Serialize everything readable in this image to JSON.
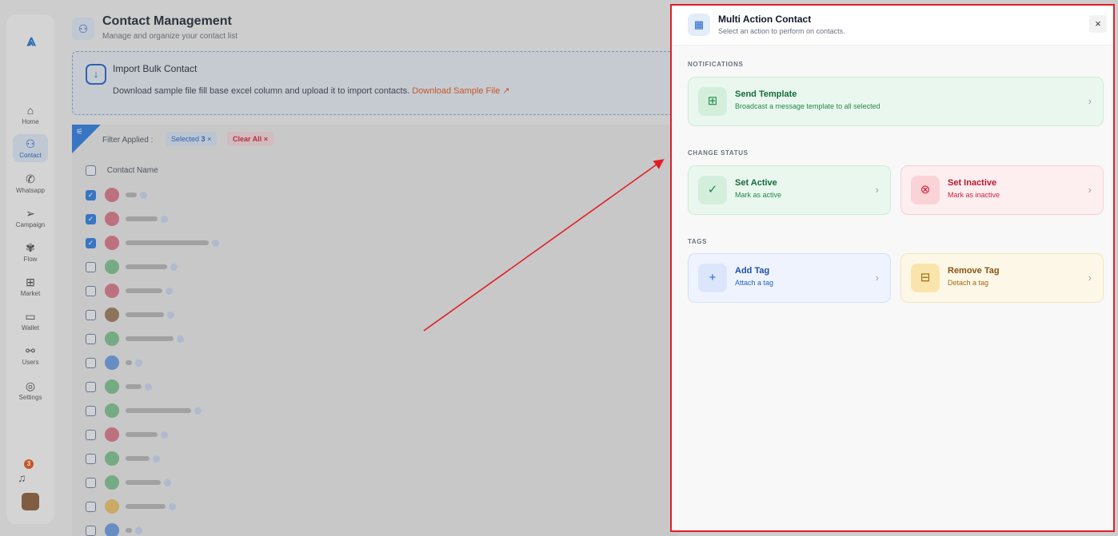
{
  "background": {
    "header": {
      "title": "Contact Management",
      "subtitle": "Manage and organize your contact list"
    },
    "sidebar": {
      "items": [
        {
          "label": "Home",
          "icon": "home-icon"
        },
        {
          "label": "Contact",
          "icon": "user-icon"
        },
        {
          "label": "Whatsapp",
          "icon": "whatsapp-icon"
        },
        {
          "label": "Campaign",
          "icon": "send-icon"
        },
        {
          "label": "Flow",
          "icon": "flow-icon"
        },
        {
          "label": "Market",
          "icon": "store-icon"
        },
        {
          "label": "Wallet",
          "icon": "wallet-icon"
        },
        {
          "label": "Users",
          "icon": "users-icon"
        },
        {
          "label": "Settings",
          "icon": "settings-icon"
        }
      ],
      "notification_count": "3"
    },
    "import": {
      "title": "Import Bulk Contact",
      "description": "Download sample file fill base excel column and upload it to import contacts.",
      "link_label": "Download Sample File"
    },
    "filters": {
      "label": "Filter Applied :",
      "selected_label": "Selected",
      "selected_count": "3",
      "clear_label": "Clear All"
    },
    "table": {
      "column_header": "Contact Name"
    }
  },
  "panel": {
    "title": "Multi Action Contact",
    "subtitle": "Select an action to perform on contacts.",
    "close_label": "×",
    "sections": {
      "notifications": "NOTIFICATIONS",
      "change_status": "CHANGE STATUS",
      "tags": "TAGS"
    },
    "actions": {
      "send_template": {
        "title": "Send Template",
        "subtitle": "Broadcast a message template to all selected"
      },
      "set_active": {
        "title": "Set Active",
        "subtitle": "Mark as active"
      },
      "set_inactive": {
        "title": "Set Inactive",
        "subtitle": "Mark as inactive"
      },
      "add_tag": {
        "title": "Add Tag",
        "subtitle": "Attach a tag"
      },
      "remove_tag": {
        "title": "Remove Tag",
        "subtitle": "Detach a tag"
      }
    }
  },
  "colors": {
    "accent": "#2563c9",
    "highlight_border": "#e21d26",
    "arrow": "#e21d26"
  }
}
